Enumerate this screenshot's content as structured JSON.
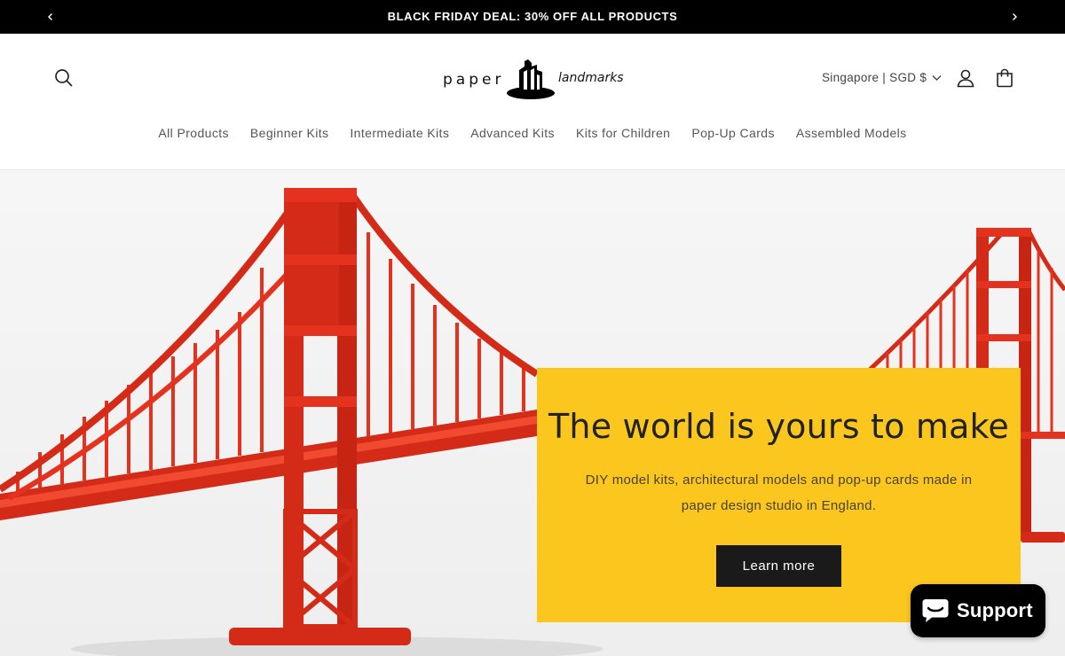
{
  "announcement": {
    "text": "BLACK FRIDAY DEAL: 30% OFF ALL PRODUCTS"
  },
  "header": {
    "logo": {
      "word_left": "paper",
      "word_right": "landmarks"
    },
    "currency_selector": "Singapore | SGD $",
    "icons": [
      "search-icon",
      "account-icon",
      "cart-icon"
    ]
  },
  "nav": {
    "items": [
      "All Products",
      "Beginner Kits",
      "Intermediate Kits",
      "Advanced Kits",
      "Kits for Children",
      "Pop-Up Cards",
      "Assembled Models"
    ]
  },
  "hero": {
    "title": "The world is yours to make",
    "description": "DIY model kits, architectural models and pop-up cards made in paper design studio in England.",
    "button_label": "Learn more",
    "panel_color": "#fbc71f",
    "bridge_color": "#e5321e"
  },
  "support_widget": {
    "label": "Support"
  }
}
